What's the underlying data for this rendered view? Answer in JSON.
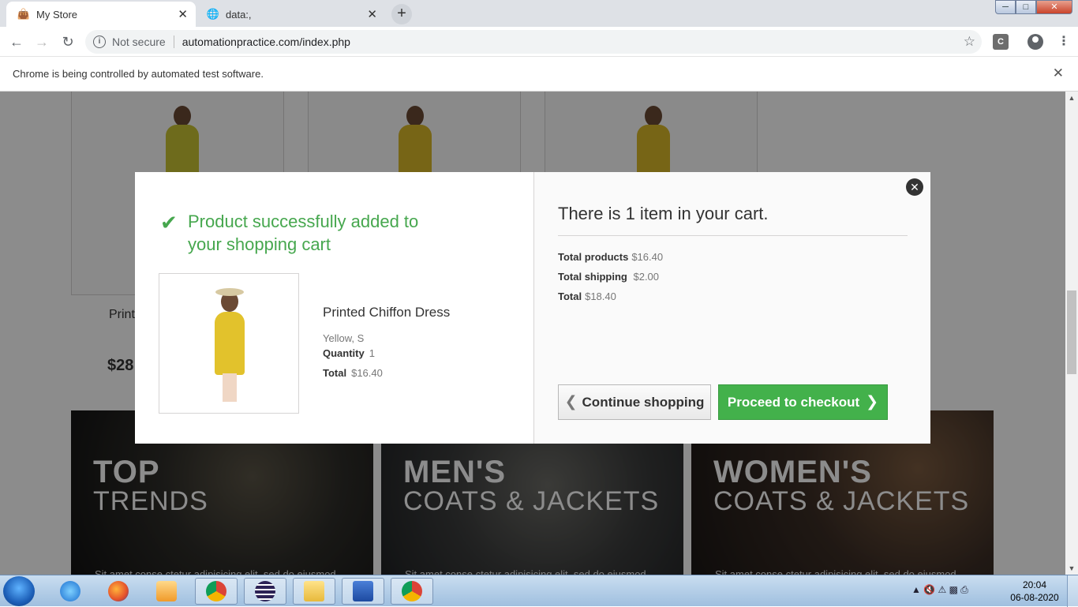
{
  "browser": {
    "tabs": [
      {
        "title": "My Store",
        "active": true
      },
      {
        "title": "data:,",
        "active": false
      }
    ],
    "security": "Not secure",
    "url": "automationpractice.com/index.php",
    "extension_label": "C",
    "automation_notice": "Chrome is being controlled by automated test software."
  },
  "page": {
    "product_name_partial": "Print",
    "product_price_partial": "$28",
    "banners": [
      {
        "title": "TOP",
        "subtitle": "TRENDS",
        "desc": "Sit amet conse ctetur adipisicing elit, sed do eiusmod"
      },
      {
        "title": "MEN'S",
        "subtitle": "COATS & JACKETS",
        "desc": "Sit amet conse ctetur adipisicing elit, sed do eiusmod"
      },
      {
        "title": "WOMEN'S",
        "subtitle": "COATS & JACKETS",
        "desc": "Sit amet conse ctetur adipisicing elit, sed do eiusmod"
      }
    ]
  },
  "modal": {
    "success_message": "Product successfully added to your shopping cart",
    "product": {
      "name": "Printed Chiffon Dress",
      "attributes": "Yellow, S",
      "quantity_label": "Quantity",
      "quantity": "1",
      "total_label": "Total",
      "total": "$16.40"
    },
    "cart": {
      "title": "There is 1 item in your cart.",
      "total_products_label": "Total products",
      "total_products": "$16.40",
      "total_shipping_label": "Total shipping",
      "total_shipping": "$2.00",
      "total_label": "Total",
      "total": "$18.40"
    },
    "continue_label": "Continue shopping",
    "checkout_label": "Proceed to checkout"
  },
  "taskbar": {
    "time": "20:04",
    "date": "06-08-2020"
  },
  "colors": {
    "success_green": "#46a74e",
    "checkout_button": "#43b14b",
    "overlay": "rgba(0,0,0,0.45)"
  }
}
